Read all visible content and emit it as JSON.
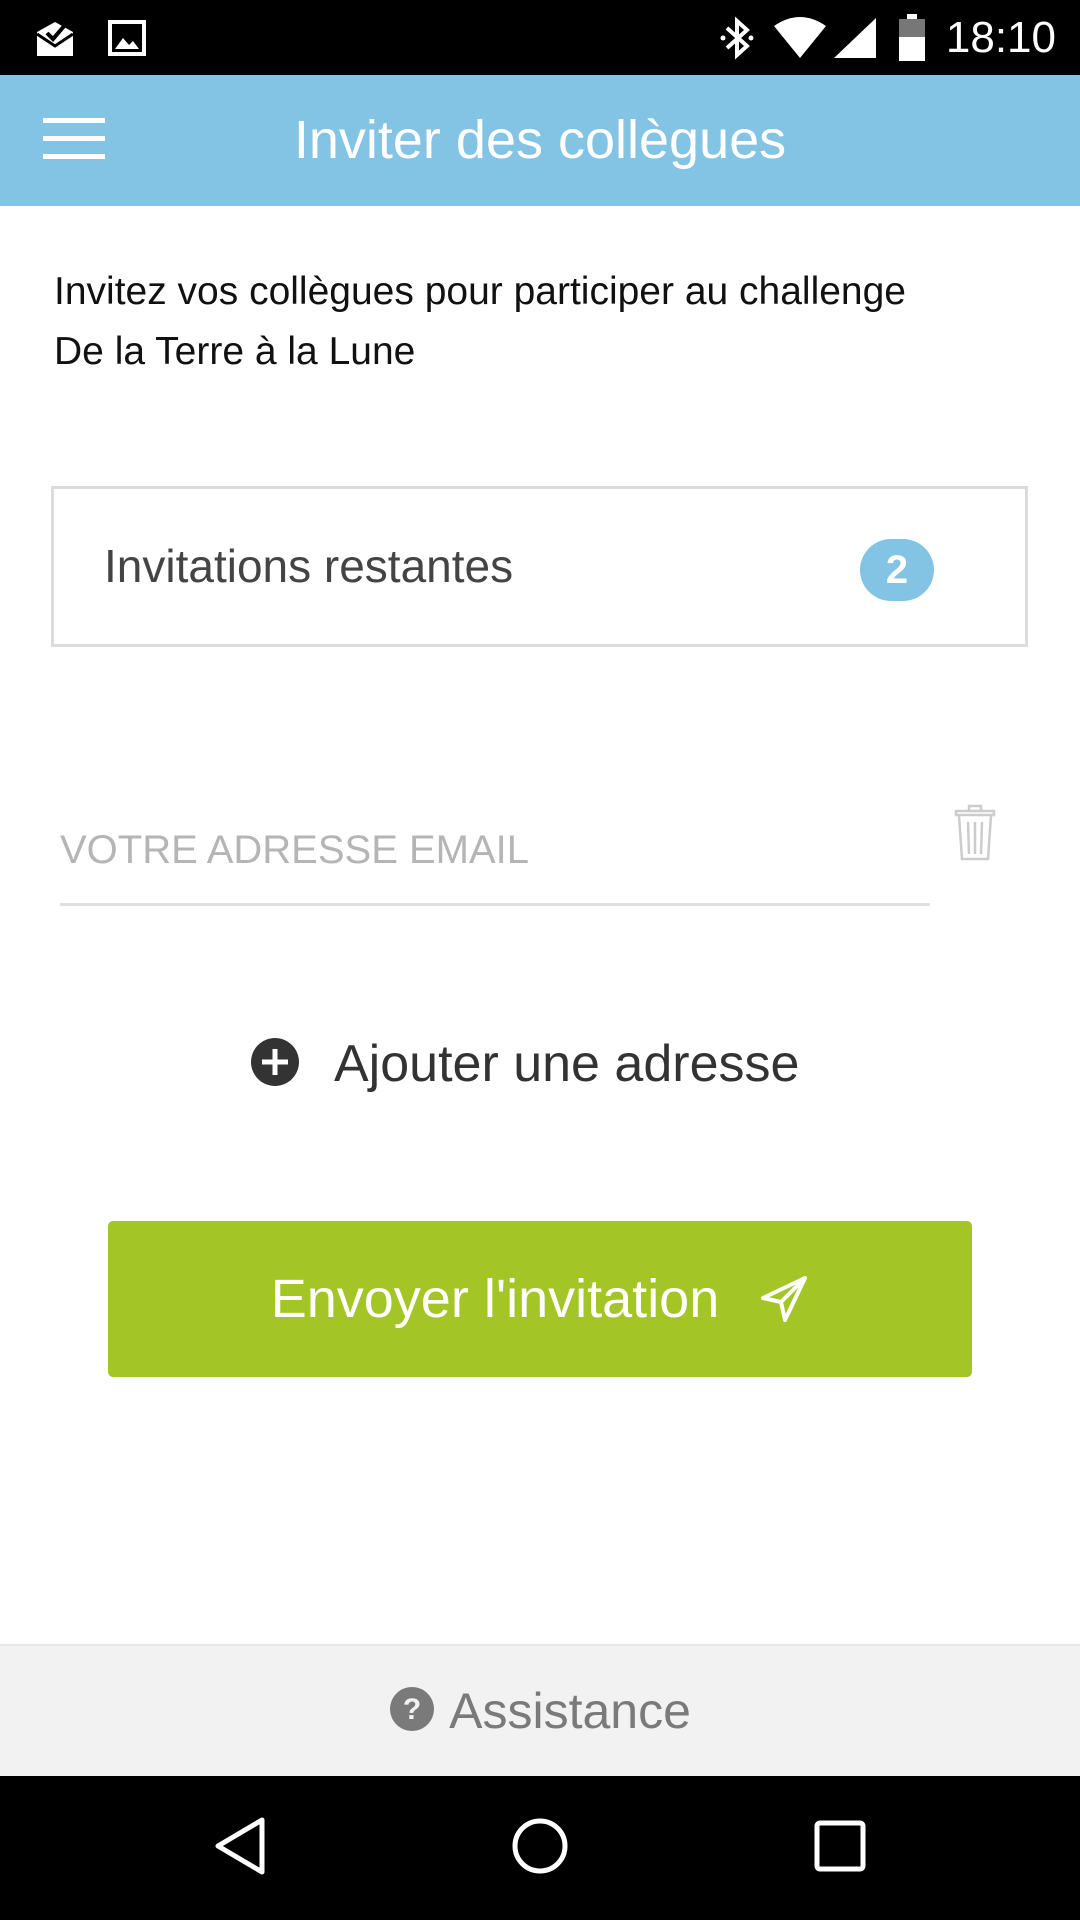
{
  "status_bar": {
    "time": "18:10",
    "left_icons": [
      "mail-check-icon",
      "image-icon"
    ],
    "right_icons": [
      "bluetooth-icon",
      "wifi-icon",
      "cellular-signal-icon",
      "battery-icon"
    ]
  },
  "app_bar": {
    "title": "Inviter des collègues",
    "menu_icon": "hamburger-menu-icon",
    "color": "#83c3e3"
  },
  "intro": {
    "line1": "Invitez vos collègues pour participer au challenge",
    "line2": "De la Terre à la Lune"
  },
  "invitations": {
    "label": "Invitations restantes",
    "count": "2"
  },
  "email": {
    "placeholder": "VOTRE ADRESSE EMAIL",
    "value": "",
    "delete_icon": "trash-icon"
  },
  "add_address": {
    "label": "Ajouter une adresse",
    "icon": "plus-circle-icon"
  },
  "send_button": {
    "label": "Envoyer l'invitation",
    "icon": "paper-plane-icon",
    "color": "#a3c626"
  },
  "footer": {
    "label": "Assistance",
    "icon": "question-circle-icon"
  },
  "nav_bar": {
    "buttons": [
      "back-icon",
      "home-icon",
      "recents-icon"
    ]
  }
}
